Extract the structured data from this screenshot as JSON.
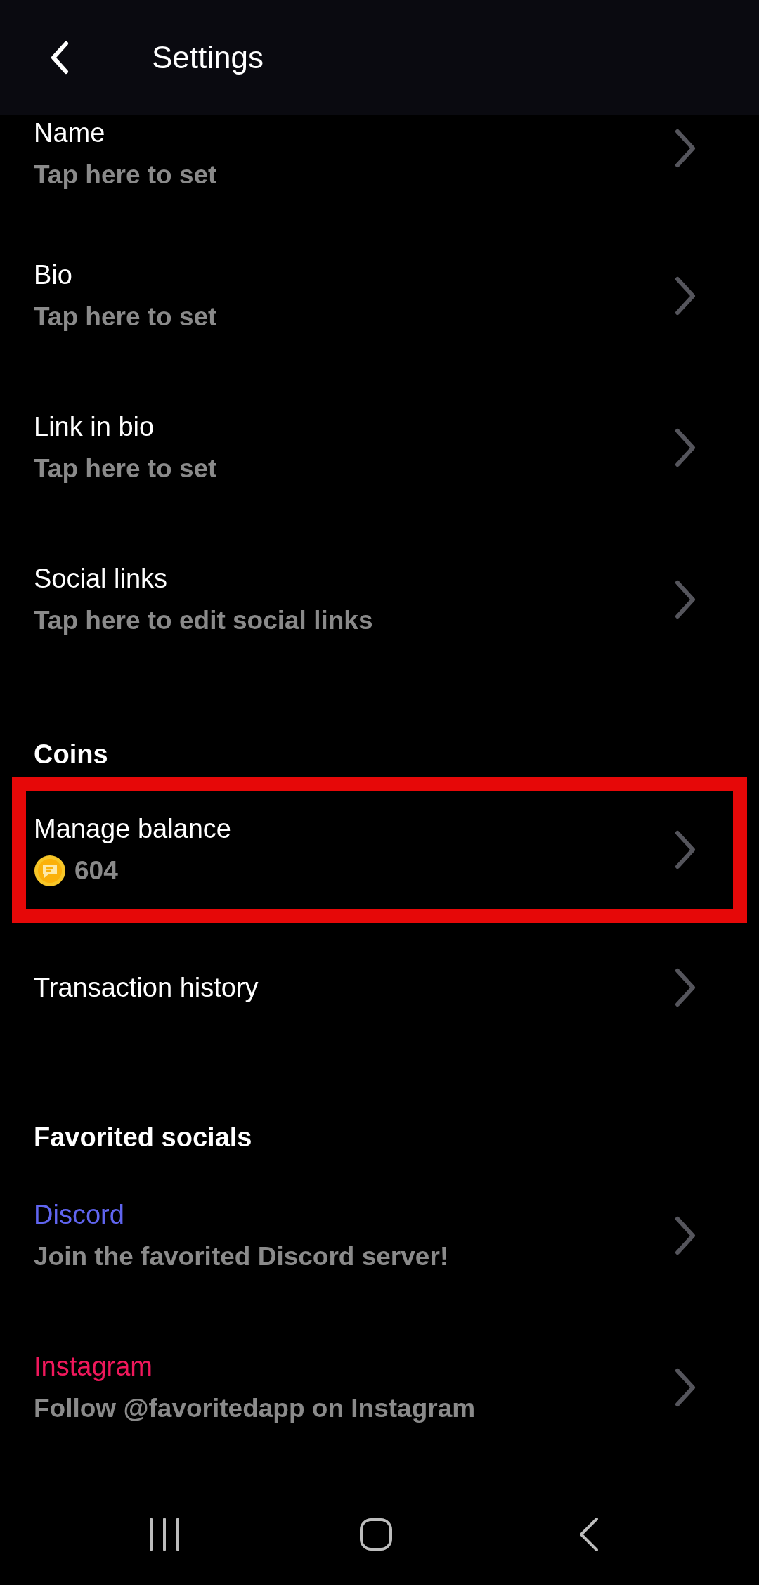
{
  "header": {
    "title": "Settings"
  },
  "sections": [
    {
      "items": [
        {
          "kind": "setting",
          "title": "Name",
          "subtitle": "Tap here to set",
          "highlighted": false
        },
        {
          "kind": "setting",
          "title": "Bio",
          "subtitle": "Tap here to set",
          "highlighted": false
        },
        {
          "kind": "setting",
          "title": "Link in bio",
          "subtitle": "Tap here to set",
          "highlighted": false
        },
        {
          "kind": "setting",
          "title": "Social links",
          "subtitle": "Tap here to edit social links",
          "highlighted": false
        }
      ]
    },
    {
      "heading": "Coins",
      "items": [
        {
          "kind": "coins",
          "title": "Manage balance",
          "balance": "604",
          "highlighted": true
        },
        {
          "kind": "plain",
          "title": "Transaction history",
          "highlighted": false
        }
      ]
    },
    {
      "heading": "Favorited socials",
      "items": [
        {
          "kind": "social",
          "title": "Discord",
          "color": "#6065f0",
          "subtitle": "Join the favorited Discord server!",
          "highlighted": false
        },
        {
          "kind": "social",
          "title": "Instagram",
          "color": "#f0185c",
          "subtitle": "Follow @favoritedapp on Instagram",
          "highlighted": false
        }
      ]
    }
  ]
}
